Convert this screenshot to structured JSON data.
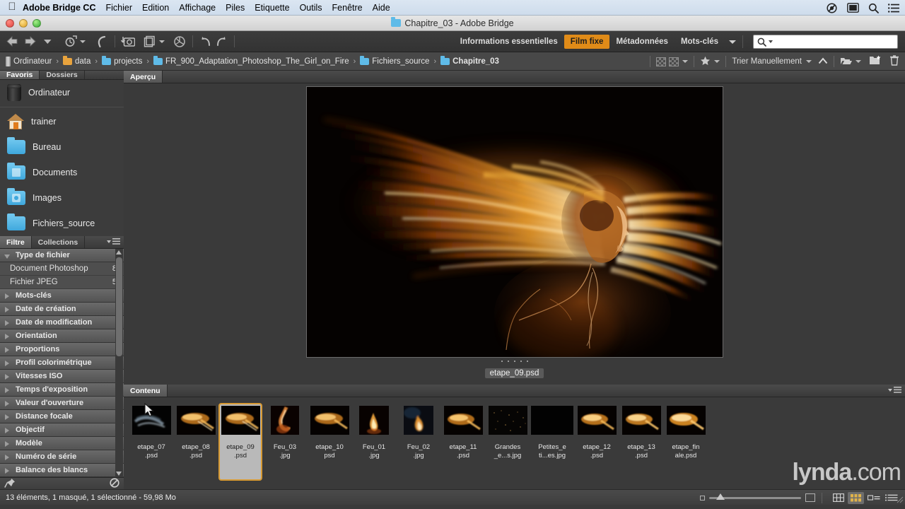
{
  "macmenu": {
    "apple_icon": "apple-logo-icon",
    "app_name": "Adobe Bridge CC",
    "items": [
      "Fichier",
      "Edition",
      "Affichage",
      "Piles",
      "Etiquette",
      "Outils",
      "Fenêtre",
      "Aide"
    ],
    "right_icons": [
      "clipping-mask-icon",
      "display-icon",
      "search-icon",
      "list-menu-icon"
    ]
  },
  "window": {
    "title": "Chapitre_03 - Adobe Bridge",
    "folder_icon": "folder-icon",
    "close_label": "close-button",
    "minimize_label": "minimize-button",
    "zoom_label": "zoom-button"
  },
  "toolbar": {
    "back_icon": "back-arrow-icon",
    "forward_icon": "forward-arrow-icon",
    "recent_icon": "chevron-down-icon",
    "revert_icon": "revert-icon",
    "rotate_ccw_icon": "rotate-counterclockwise-icon",
    "photo_downloader_icon": "photo-downloader-icon",
    "refine_icon": "refine-icon",
    "open_in_camera_raw_icon": "camera-raw-icon",
    "rotate_left_icon": "rotate-left-icon",
    "rotate_right_icon": "rotate-right-icon",
    "workspaces": [
      {
        "label": "Informations essentielles",
        "active": false
      },
      {
        "label": "Film fixe",
        "active": true
      },
      {
        "label": "Métadonnées",
        "active": false
      },
      {
        "label": "Mots-clés",
        "active": false
      }
    ],
    "workspace_dropdown_icon": "chevron-down-icon",
    "search_icon": "search-icon",
    "search_value": "",
    "search_placeholder": "",
    "accent_color": "#e08b18"
  },
  "pathbar": {
    "crumbs": [
      {
        "label": "Ordinateur",
        "icon": "drive-icon"
      },
      {
        "label": "data",
        "icon": "folder-orange-icon"
      },
      {
        "label": "projects",
        "icon": "folder-icon"
      },
      {
        "label": "FR_900_Adaptation_Photoshop_The_Girl_on_Fire",
        "icon": "folder-icon"
      },
      {
        "label": "Fichiers_source",
        "icon": "folder-icon"
      },
      {
        "label": "Chapitre_03",
        "icon": "folder-icon"
      }
    ],
    "separator": "›",
    "right": {
      "filter_rejected_icon": "checkerboard-icon",
      "filter_hidden_icon": "checkerboard-alt-icon",
      "filter_dropdown_icon": "chevron-down-icon",
      "rating_icon": "star-icon",
      "rating_dropdown_icon": "chevron-down-icon",
      "sort_label": "Trier Manuellement",
      "sort_dropdown_icon": "chevron-down-icon",
      "sort_direction_icon": "chevron-up-icon",
      "new_folder_icon": "open-folder-icon",
      "new_folder_dropdown_icon": "chevron-down-icon",
      "create_folder_icon": "new-folder-icon",
      "delete_icon": "trash-icon"
    }
  },
  "sidebar": {
    "tabs": [
      {
        "label": "Favoris",
        "active": true
      },
      {
        "label": "Dossiers",
        "active": false
      }
    ],
    "favorites": [
      {
        "label": "Ordinateur",
        "icon": "computer-icon"
      },
      {
        "label": "trainer",
        "icon": "home-icon"
      },
      {
        "label": "Bureau",
        "icon": "folder-icon"
      },
      {
        "label": "Documents",
        "icon": "folder-documents-icon"
      },
      {
        "label": "Images",
        "icon": "folder-pictures-icon"
      },
      {
        "label": "Fichiers_source",
        "icon": "folder-icon"
      }
    ]
  },
  "filter_panel": {
    "tabs": [
      {
        "label": "Filtre",
        "active": true
      },
      {
        "label": "Collections",
        "active": false
      }
    ],
    "menu_icon": "panel-menu-icon",
    "groups": [
      {
        "label": "Type de fichier",
        "expanded": true,
        "rows": [
          {
            "label": "Document Photoshop",
            "count": "8"
          },
          {
            "label": "Fichier JPEG",
            "count": "5"
          }
        ]
      },
      {
        "label": "Mots-clés",
        "expanded": false,
        "rows": []
      },
      {
        "label": "Date de création",
        "expanded": false,
        "rows": []
      },
      {
        "label": "Date de modification",
        "expanded": false,
        "rows": []
      },
      {
        "label": "Orientation",
        "expanded": false,
        "rows": []
      },
      {
        "label": "Proportions",
        "expanded": false,
        "rows": []
      },
      {
        "label": "Profil colorimétrique",
        "expanded": false,
        "rows": []
      },
      {
        "label": "Vitesses ISO",
        "expanded": false,
        "rows": []
      },
      {
        "label": "Temps d'exposition",
        "expanded": false,
        "rows": []
      },
      {
        "label": "Valeur d'ouverture",
        "expanded": false,
        "rows": []
      },
      {
        "label": "Distance focale",
        "expanded": false,
        "rows": []
      },
      {
        "label": "Objectif",
        "expanded": false,
        "rows": []
      },
      {
        "label": "Modèle",
        "expanded": false,
        "rows": []
      },
      {
        "label": "Numéro de série",
        "expanded": false,
        "rows": []
      },
      {
        "label": "Balance des blancs",
        "expanded": false,
        "rows": []
      }
    ],
    "footer": {
      "keep_filter_icon": "pushpin-icon",
      "clear_filter_icon": "clear-filter-icon"
    }
  },
  "preview_pane": {
    "tabs": [
      {
        "label": "Aperçu",
        "active": true
      }
    ],
    "image_alt": "girl-on-fire-preview",
    "caption": "etape_09.psd"
  },
  "content_pane": {
    "tabs": [
      {
        "label": "Contenu",
        "active": true
      }
    ],
    "thumbnails": [
      {
        "line1": "etape_07",
        "line2": ".psd",
        "selected": false,
        "style": "blue-smoke"
      },
      {
        "line1": "etape_08",
        "line2": ".psd",
        "selected": false,
        "style": "fire-hair"
      },
      {
        "line1": "etape_09",
        "line2": ".psd",
        "selected": true,
        "style": "fire-hair"
      },
      {
        "line1": "Feu_03",
        "line2": ".jpg",
        "selected": false,
        "style": "flame-tall"
      },
      {
        "line1": "etape_10",
        "line2": "psd",
        "selected": false,
        "style": "fire-hair"
      },
      {
        "line1": "Feu_01",
        "line2": ".jpg",
        "selected": false,
        "style": "flame-small"
      },
      {
        "line1": "Feu_02",
        "line2": ".jpg",
        "selected": false,
        "style": "flame-blue"
      },
      {
        "line1": "etape_11",
        "line2": ".psd",
        "selected": false,
        "style": "fire-hair"
      },
      {
        "line1": "Grandes",
        "line2": "_e...s.jpg",
        "selected": false,
        "style": "sparks"
      },
      {
        "line1": "Petites_e",
        "line2": "ti...es.jpg",
        "selected": false,
        "style": "black"
      },
      {
        "line1": "etape_12",
        "line2": ".psd",
        "selected": false,
        "style": "fire-hair"
      },
      {
        "line1": "etape_13",
        "line2": ".psd",
        "selected": false,
        "style": "fire-hair"
      },
      {
        "line1": "etape_fin",
        "line2": "ale.psd",
        "selected": false,
        "style": "fire-hair"
      }
    ],
    "watermark_brand": "lynda",
    "watermark_tld": ".com",
    "selection_color": "#d89a33"
  },
  "statusbar": {
    "text": "13 éléments, 1 masqué, 1 sélectionné - 59,98 Mo",
    "zoom_small_icon": "small-thumbnail-icon",
    "zoom_big_icon": "large-thumbnail-icon",
    "views": [
      {
        "icon": "grid-view-icon",
        "active": false
      },
      {
        "icon": "thumbnail-view-icon",
        "active": true
      },
      {
        "icon": "details-view-icon",
        "active": false
      },
      {
        "icon": "list-view-icon",
        "active": false
      }
    ],
    "resize_grip_icon": "resize-grip-icon"
  }
}
